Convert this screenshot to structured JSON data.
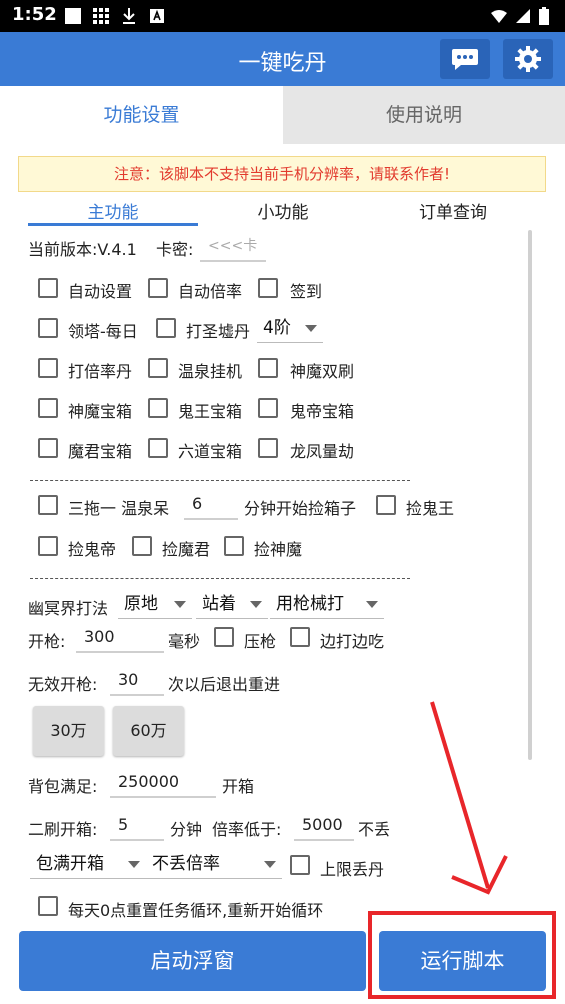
{
  "status_bar": {
    "time": "1:52"
  },
  "app_bar": {
    "title": "一键吃丹",
    "chat_icon": "chat-bubble-icon",
    "settings_icon": "gear-icon"
  },
  "tabs": [
    {
      "label": "功能设置",
      "active": true
    },
    {
      "label": "使用说明",
      "active": false
    }
  ],
  "notice": "注意：该脚本不支持当前手机分辨率，请联系作者!",
  "sub_tabs": [
    {
      "label": "主功能",
      "active": true
    },
    {
      "label": "小功能",
      "active": false
    },
    {
      "label": "订单查询",
      "active": false
    }
  ],
  "version": {
    "label": "当前版本:V.4.1",
    "card_label": "卡密:",
    "card_placeholder": "<<<卡"
  },
  "checkboxes": {
    "auto_setup": "自动设置",
    "auto_multiplier": "自动倍率",
    "sign_in": "签到",
    "tower_daily": "领塔-每日",
    "holy_furnace": "打圣墟丹",
    "multiplier_pill": "打倍率丹",
    "hot_spring_idle": "温泉挂机",
    "divine_demon_double": "神魔双刷",
    "divine_demon_chest": "神魔宝箱",
    "ghost_king_chest": "鬼王宝箱",
    "ghost_emperor_chest": "鬼帝宝箱",
    "demon_lord_chest": "魔君宝箱",
    "six_paths_chest": "六道宝箱",
    "dragon_phoenix": "龙凤量劫",
    "three_drag": "三拖一 温泉呆",
    "pick_ghost_king": "捡鬼王",
    "pick_ghost_emperor": "捡鬼帝",
    "pick_demon_lord": "捡魔君",
    "pick_divine_demon": "捡神魔",
    "suppress_gun": "压枪",
    "shoot_while_eating": "边打边吃",
    "upper_limit_drop": "上限丢丹",
    "daily_reset": "每天0点重置任务循环,重新开始循环"
  },
  "holy_furnace_level": "4阶",
  "hot_spring": {
    "minutes": "6",
    "suffix": "分钟开始捡箱子"
  },
  "nether": {
    "label": "幽冥界打法",
    "position": "原地",
    "stance": "站着",
    "weapon": "用枪械打"
  },
  "fire": {
    "label": "开枪:",
    "value": "300",
    "unit": "毫秒"
  },
  "invalid_fire": {
    "label": "无效开枪:",
    "value": "30",
    "suffix": "次以后退出重进"
  },
  "preset_buttons": [
    "30万",
    "60万"
  ],
  "bag_full": {
    "label": "背包满足:",
    "value": "250000",
    "suffix": "开箱"
  },
  "second_open": {
    "label": "二刷开箱:",
    "value": "5",
    "unit": "分钟",
    "rate_label": "倍率低于:",
    "rate_value": "5000",
    "rate_suffix": "不丢"
  },
  "bag_mode": "包满开箱",
  "drop_mode": "不丢倍率",
  "actions": {
    "float_window": "启动浮窗",
    "run_script": "运行脚本"
  },
  "colors": {
    "primary": "#3a7bd5",
    "notice_text": "#e23b2e",
    "highlight": "#e8262a"
  }
}
